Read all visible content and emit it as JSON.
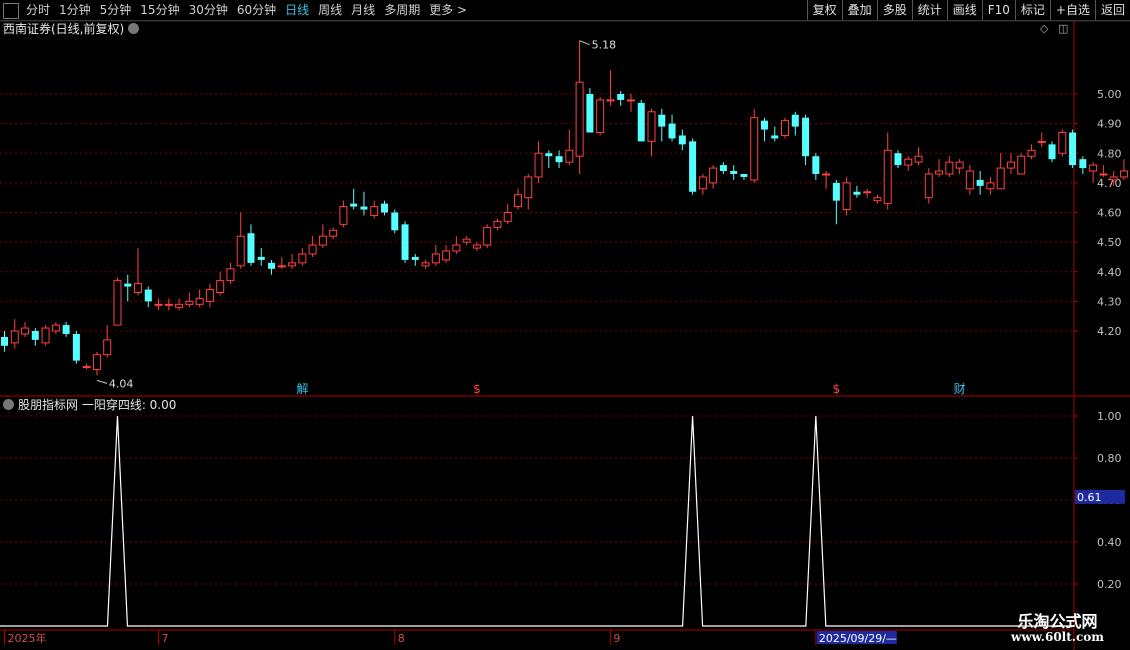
{
  "toolbar": {
    "periods": [
      {
        "label": "分时",
        "active": false
      },
      {
        "label": "1分钟",
        "active": false
      },
      {
        "label": "5分钟",
        "active": false
      },
      {
        "label": "15分钟",
        "active": false
      },
      {
        "label": "30分钟",
        "active": false
      },
      {
        "label": "60分钟",
        "active": false
      },
      {
        "label": "日线",
        "active": true
      },
      {
        "label": "周线",
        "active": false
      },
      {
        "label": "月线",
        "active": false
      },
      {
        "label": "多周期",
        "active": false
      },
      {
        "label": "更多 >",
        "active": false
      }
    ],
    "actions": [
      "复权",
      "叠加",
      "多股",
      "统计",
      "画线",
      "F10",
      "标记",
      "+自选",
      "返回"
    ]
  },
  "main_pane": {
    "title": "西南证券(日线,前复权)"
  },
  "sub_pane": {
    "title": "股朋指标网 一阳穿四线: 0.00"
  },
  "colors": {
    "up": "#ff4040",
    "down": "#54ffff",
    "grid": "#7a0000",
    "axis": "#c0c0c0",
    "indicator": "#ffffff",
    "marker_blue": "#1e2aa0"
  },
  "chart_data": [
    {
      "type": "candlestick",
      "title": "西南证券(日线,前复权)",
      "y_ticks": [
        5.0,
        4.9,
        4.8,
        4.7,
        4.6,
        4.5,
        4.4,
        4.3,
        4.2
      ],
      "y_tick_labels": [
        "5.00",
        "4.90",
        "4.80",
        "4.70",
        "4.60",
        "4.50",
        "4.40",
        "4.30",
        "4.20"
      ],
      "high_label": "5.18",
      "low_label": "4.04",
      "event_markers": [
        {
          "date_index": 29,
          "label": "解",
          "color": "#35c3e8"
        },
        {
          "date_index": 46,
          "label": "$",
          "color": "#ff4040"
        },
        {
          "date_index": 81,
          "label": "$",
          "color": "#ff4040"
        },
        {
          "date_index": 93,
          "label": "财",
          "color": "#35c3e8"
        }
      ],
      "candles": [
        [
          4.18,
          4.15,
          4.2,
          4.13
        ],
        [
          4.16,
          4.2,
          4.24,
          4.14
        ],
        [
          4.19,
          4.21,
          4.23,
          4.18
        ],
        [
          4.2,
          4.17,
          4.21,
          4.15
        ],
        [
          4.16,
          4.21,
          4.22,
          4.15
        ],
        [
          4.2,
          4.22,
          4.23,
          4.19
        ],
        [
          4.22,
          4.19,
          4.23,
          4.18
        ],
        [
          4.19,
          4.1,
          4.2,
          4.09
        ],
        [
          4.08,
          4.08,
          4.09,
          4.07
        ],
        [
          4.07,
          4.12,
          4.13,
          4.05
        ],
        [
          4.12,
          4.17,
          4.22,
          4.11
        ],
        [
          4.22,
          4.37,
          4.38,
          4.22
        ],
        [
          4.36,
          4.35,
          4.39,
          4.3
        ],
        [
          4.33,
          4.36,
          4.48,
          4.32
        ],
        [
          4.34,
          4.3,
          4.35,
          4.28
        ],
        [
          4.29,
          4.29,
          4.31,
          4.27
        ],
        [
          4.29,
          4.29,
          4.31,
          4.27
        ],
        [
          4.28,
          4.29,
          4.31,
          4.27
        ],
        [
          4.29,
          4.3,
          4.33,
          4.28
        ],
        [
          4.29,
          4.31,
          4.34,
          4.28
        ],
        [
          4.3,
          4.34,
          4.36,
          4.28
        ],
        [
          4.33,
          4.37,
          4.4,
          4.32
        ],
        [
          4.37,
          4.41,
          4.43,
          4.36
        ],
        [
          4.42,
          4.52,
          4.6,
          4.41
        ],
        [
          4.53,
          4.43,
          4.56,
          4.42
        ],
        [
          4.45,
          4.44,
          4.48,
          4.42
        ],
        [
          4.43,
          4.41,
          4.44,
          4.39
        ],
        [
          4.42,
          4.42,
          4.45,
          4.41
        ],
        [
          4.42,
          4.43,
          4.46,
          4.41
        ],
        [
          4.43,
          4.46,
          4.48,
          4.42
        ],
        [
          4.46,
          4.49,
          4.52,
          4.45
        ],
        [
          4.49,
          4.52,
          4.56,
          4.48
        ],
        [
          4.52,
          4.54,
          4.55,
          4.51
        ],
        [
          4.56,
          4.62,
          4.64,
          4.55
        ],
        [
          4.63,
          4.62,
          4.68,
          4.61
        ],
        [
          4.62,
          4.61,
          4.67,
          4.59
        ],
        [
          4.59,
          4.62,
          4.64,
          4.58
        ],
        [
          4.63,
          4.6,
          4.64,
          4.59
        ],
        [
          4.6,
          4.54,
          4.61,
          4.53
        ],
        [
          4.56,
          4.44,
          4.57,
          4.43
        ],
        [
          4.45,
          4.44,
          4.46,
          4.42
        ],
        [
          4.42,
          4.43,
          4.44,
          4.41
        ],
        [
          4.43,
          4.46,
          4.49,
          4.42
        ],
        [
          4.44,
          4.47,
          4.49,
          4.43
        ],
        [
          4.47,
          4.49,
          4.52,
          4.46
        ],
        [
          4.5,
          4.51,
          4.52,
          4.49
        ],
        [
          4.48,
          4.49,
          4.5,
          4.47
        ],
        [
          4.49,
          4.55,
          4.56,
          4.48
        ],
        [
          4.55,
          4.57,
          4.58,
          4.54
        ],
        [
          4.57,
          4.6,
          4.63,
          4.56
        ],
        [
          4.62,
          4.66,
          4.68,
          4.61
        ],
        [
          4.65,
          4.72,
          4.73,
          4.61
        ],
        [
          4.72,
          4.8,
          4.84,
          4.7
        ],
        [
          4.8,
          4.79,
          4.81,
          4.75
        ],
        [
          4.79,
          4.77,
          4.81,
          4.75
        ],
        [
          4.77,
          4.81,
          4.88,
          4.76
        ],
        [
          4.79,
          5.04,
          5.18,
          4.73
        ],
        [
          5.0,
          4.87,
          5.02,
          4.87
        ],
        [
          4.87,
          4.98,
          4.99,
          4.86
        ],
        [
          4.98,
          4.98,
          5.08,
          4.96
        ],
        [
          5.0,
          4.98,
          5.01,
          4.96
        ],
        [
          4.98,
          4.98,
          5.0,
          4.94
        ],
        [
          4.97,
          4.84,
          4.98,
          4.84
        ],
        [
          4.84,
          4.94,
          4.95,
          4.79
        ],
        [
          4.93,
          4.89,
          4.95,
          4.84
        ],
        [
          4.9,
          4.85,
          4.93,
          4.84
        ],
        [
          4.86,
          4.83,
          4.88,
          4.81
        ],
        [
          4.84,
          4.67,
          4.85,
          4.66
        ],
        [
          4.68,
          4.72,
          4.73,
          4.66
        ],
        [
          4.7,
          4.75,
          4.76,
          4.68
        ],
        [
          4.76,
          4.74,
          4.77,
          4.73
        ],
        [
          4.74,
          4.73,
          4.76,
          4.71
        ],
        [
          4.73,
          4.72,
          4.73,
          4.71
        ],
        [
          4.71,
          4.92,
          4.95,
          4.7
        ],
        [
          4.91,
          4.88,
          4.92,
          4.84
        ],
        [
          4.86,
          4.85,
          4.89,
          4.84
        ],
        [
          4.86,
          4.91,
          4.92,
          4.85
        ],
        [
          4.93,
          4.89,
          4.94,
          4.86
        ],
        [
          4.92,
          4.79,
          4.93,
          4.76
        ],
        [
          4.79,
          4.73,
          4.8,
          4.71
        ],
        [
          4.73,
          4.73,
          4.74,
          4.68
        ],
        [
          4.7,
          4.64,
          4.71,
          4.56
        ],
        [
          4.61,
          4.7,
          4.72,
          4.59
        ],
        [
          4.67,
          4.66,
          4.69,
          4.65
        ],
        [
          4.67,
          4.67,
          4.68,
          4.65
        ],
        [
          4.64,
          4.65,
          4.66,
          4.63
        ],
        [
          4.63,
          4.81,
          4.87,
          4.61
        ],
        [
          4.8,
          4.76,
          4.81,
          4.75
        ],
        [
          4.76,
          4.78,
          4.79,
          4.74
        ],
        [
          4.77,
          4.79,
          4.82,
          4.76
        ],
        [
          4.65,
          4.73,
          4.75,
          4.63
        ],
        [
          4.73,
          4.74,
          4.78,
          4.72
        ],
        [
          4.73,
          4.77,
          4.79,
          4.72
        ],
        [
          4.75,
          4.77,
          4.78,
          4.73
        ],
        [
          4.68,
          4.74,
          4.76,
          4.66
        ],
        [
          4.71,
          4.69,
          4.74,
          4.66
        ],
        [
          4.68,
          4.7,
          4.72,
          4.66
        ],
        [
          4.68,
          4.75,
          4.8,
          4.68
        ],
        [
          4.75,
          4.77,
          4.8,
          4.73
        ],
        [
          4.73,
          4.79,
          4.8,
          4.73
        ],
        [
          4.79,
          4.81,
          4.83,
          4.78
        ],
        [
          4.84,
          4.84,
          4.87,
          4.82
        ],
        [
          4.83,
          4.78,
          4.84,
          4.77
        ],
        [
          4.8,
          4.87,
          4.88,
          4.79
        ],
        [
          4.87,
          4.76,
          4.88,
          4.75
        ],
        [
          4.78,
          4.75,
          4.79,
          4.73
        ],
        [
          4.74,
          4.76,
          4.77,
          4.7
        ],
        [
          4.73,
          4.73,
          4.76,
          4.72
        ],
        [
          4.71,
          4.72,
          4.74,
          4.69
        ],
        [
          4.72,
          4.74,
          4.78,
          4.71
        ]
      ]
    },
    {
      "type": "line",
      "title": "股朋指标网 一阳穿四线: 0.00",
      "series_name": "一阳穿四线",
      "current_value": "0.00",
      "y_ticks": [
        1.0,
        0.8,
        0.6,
        0.4,
        0.2
      ],
      "y_tick_labels": [
        "1.00",
        "0.80",
        "0.60",
        "0.40",
        "0.20"
      ],
      "cursor_value_label": "0.61",
      "signals_at_index": [
        11,
        67,
        79
      ],
      "x_labels": [
        {
          "index": 0,
          "label": "2025年"
        },
        {
          "index": 15,
          "label": "7"
        },
        {
          "index": 38,
          "label": "8"
        },
        {
          "index": 59,
          "label": "9"
        },
        {
          "index": 79,
          "label": "2025/09/29/—",
          "highlight": true
        }
      ]
    }
  ]
}
